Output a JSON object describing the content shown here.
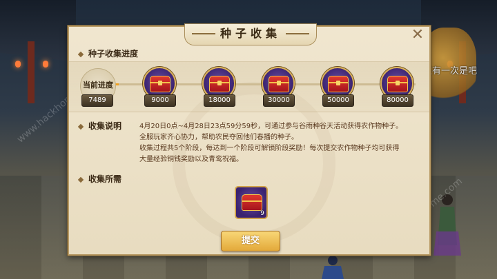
{
  "panel": {
    "title": "种子收集",
    "close_glyph": "✕",
    "progress_section": "种子收集进度",
    "current_label": "当前进度",
    "current_value": "7489",
    "progress_fraction": 0.09,
    "tiers": [
      {
        "value": "9000",
        "icon": "treasure-chest-icon"
      },
      {
        "value": "18000",
        "icon": "treasure-chest-icon"
      },
      {
        "value": "30000",
        "icon": "treasure-chest-icon"
      },
      {
        "value": "50000",
        "icon": "treasure-chest-icon"
      },
      {
        "value": "80000",
        "icon": "treasure-chest-icon"
      }
    ],
    "desc_section": "收集说明",
    "desc_lines": [
      "4月20日0点~4月28日23点59分59秒，可通过参与谷雨种谷天活动获得农作物种子。",
      "全服玩家齐心协力，帮助农民夺回他们春播的种子。",
      "收集过程共5个阶段，每达到一个阶段可解锁阶段奖励！每次提交农作物种子均可获得",
      "大量经验铜钱奖励以及青鸾祝福。"
    ],
    "need_section": "收集所需",
    "need_item_count": "9",
    "need_item_icon": "seed-chest-icon",
    "submit_label": "提交"
  },
  "chat_text": "微风轻轻语：还有一次是吧",
  "watermark": "www.hackhome.com",
  "colors": {
    "accent_gold": "#f0a020",
    "panel_bg": "#f0e6cf",
    "chest_purple": "#3a2270"
  }
}
